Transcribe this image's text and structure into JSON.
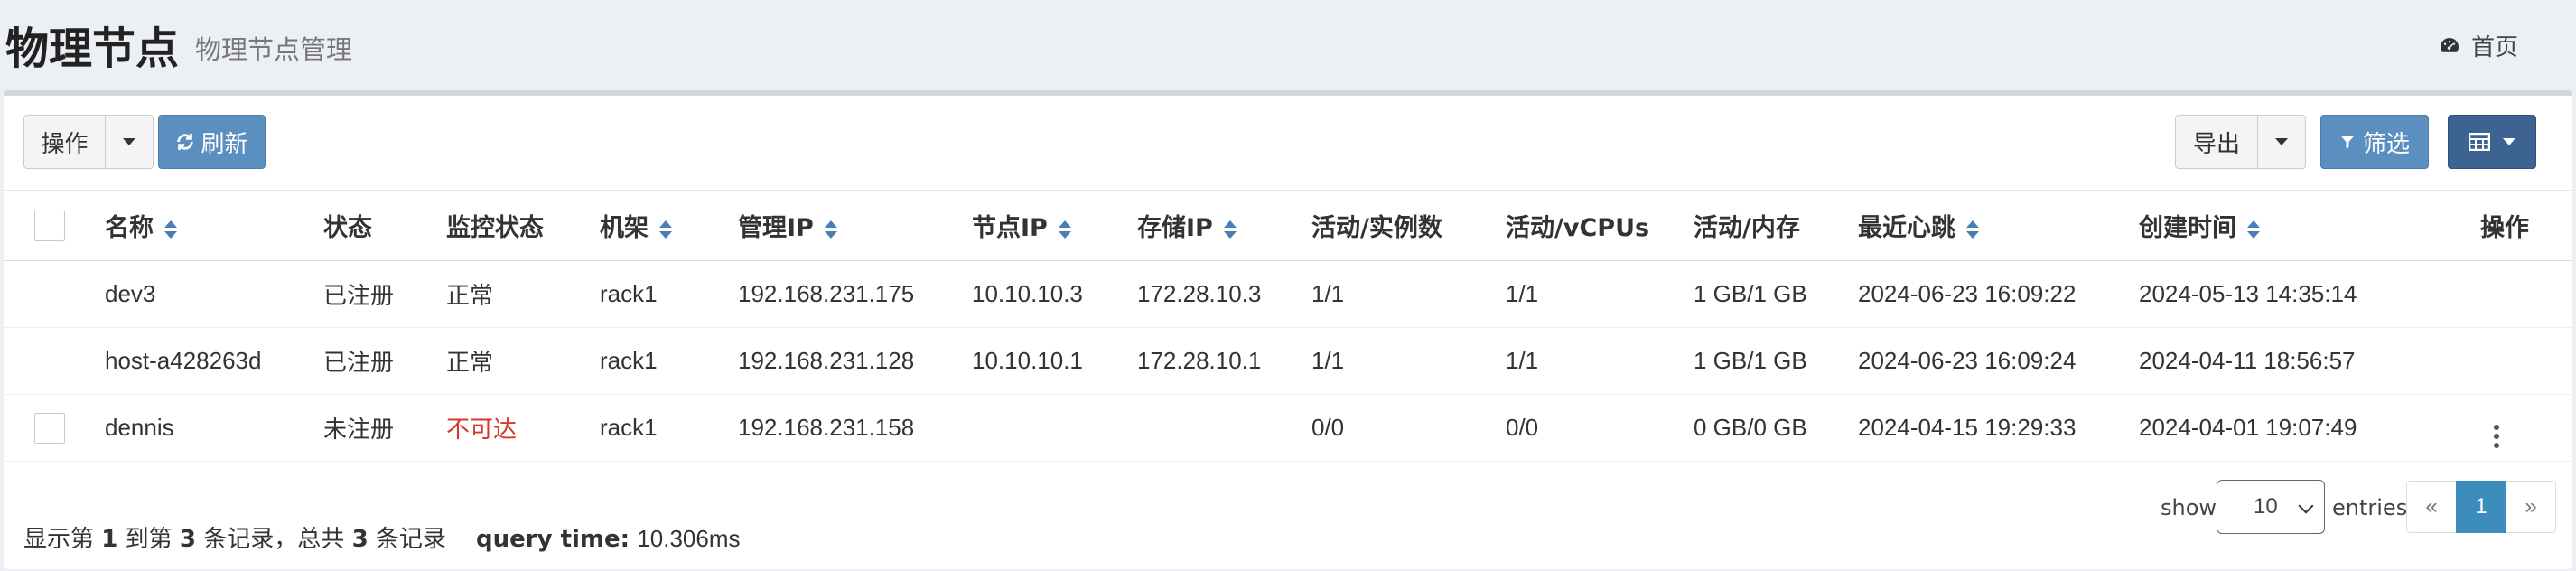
{
  "header": {
    "title": "物理节点",
    "subtitle": "物理节点管理",
    "home_label": "首页"
  },
  "toolbar": {
    "actions_label": "操作",
    "refresh_label": "刷新",
    "export_label": "导出",
    "filter_label": "筛选"
  },
  "table": {
    "columns": [
      "名称",
      "状态",
      "监控状态",
      "机架",
      "管理IP",
      "节点IP",
      "存储IP",
      "活动/实例数",
      "活动/vCPUs",
      "活动/内存",
      "最近心跳",
      "创建时间",
      "操作"
    ],
    "rows": [
      {
        "name": "dev3",
        "status": "已注册",
        "monitor": "正常",
        "rack": "rack1",
        "mgmt_ip": "192.168.231.175",
        "node_ip": "10.10.10.3",
        "storage_ip": "172.28.10.3",
        "instances": "1/1",
        "vcpus": "1/1",
        "memory": "1 GB/1 GB",
        "heartbeat": "2024-06-23 16:09:22",
        "created": "2024-05-13 14:35:14"
      },
      {
        "name": "host-a428263d",
        "status": "已注册",
        "monitor": "正常",
        "rack": "rack1",
        "mgmt_ip": "192.168.231.128",
        "node_ip": "10.10.10.1",
        "storage_ip": "172.28.10.1",
        "instances": "1/1",
        "vcpus": "1/1",
        "memory": "1 GB/1 GB",
        "heartbeat": "2024-06-23 16:09:24",
        "created": "2024-04-11 18:56:57"
      },
      {
        "name": "dennis",
        "status": "未注册",
        "monitor": "不可达",
        "rack": "rack1",
        "mgmt_ip": "192.168.231.158",
        "node_ip": "",
        "storage_ip": "",
        "instances": "0/0",
        "vcpus": "0/0",
        "memory": "0 GB/0 GB",
        "heartbeat": "2024-04-15 19:29:33",
        "created": "2024-04-01 19:07:49"
      }
    ]
  },
  "footer": {
    "summary_prefix": "显示第",
    "from": "1",
    "summary_to": "到第",
    "to": "3",
    "summary_total": "条记录，总共",
    "total": "3",
    "summary_suffix": "条记录",
    "query_label": "query time:",
    "query_time": "10.306ms",
    "show_label": "show",
    "page_size": "10",
    "entries_label": "entries",
    "prev": "«",
    "current_page": "1",
    "next": "»"
  },
  "colors": {
    "primary": "#5b8fbf",
    "dark": "#3c6391",
    "danger": "#d43a2f",
    "page_bg": "#ecf0f5"
  }
}
